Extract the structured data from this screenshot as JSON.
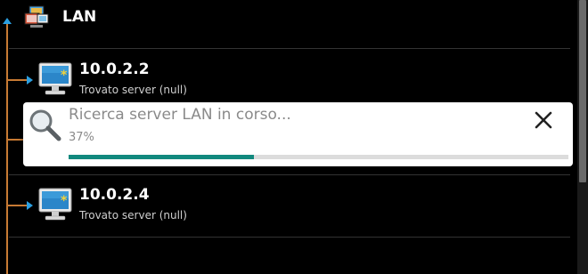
{
  "lan_header": {
    "title": "LAN",
    "icon": "lan-network-icon"
  },
  "servers": [
    {
      "name": "10.0.2.2",
      "status": "Trovato server (null)",
      "icon": "monitor-icon"
    },
    {
      "name": "10.0.2.4",
      "status": "Trovato server (null)",
      "icon": "monitor-icon"
    }
  ],
  "dialog": {
    "message": "Ricerca server LAN in corso...",
    "percent_label": "37%",
    "progress": 0.37,
    "close_icon": "close-icon",
    "search_icon": "search-icon"
  },
  "colors": {
    "background": "#000000",
    "tree_line": "#c77a33",
    "tree_arrow": "#2b9fe0",
    "progress_fill": "#12897e",
    "progress_track": "#dcdcdc"
  }
}
